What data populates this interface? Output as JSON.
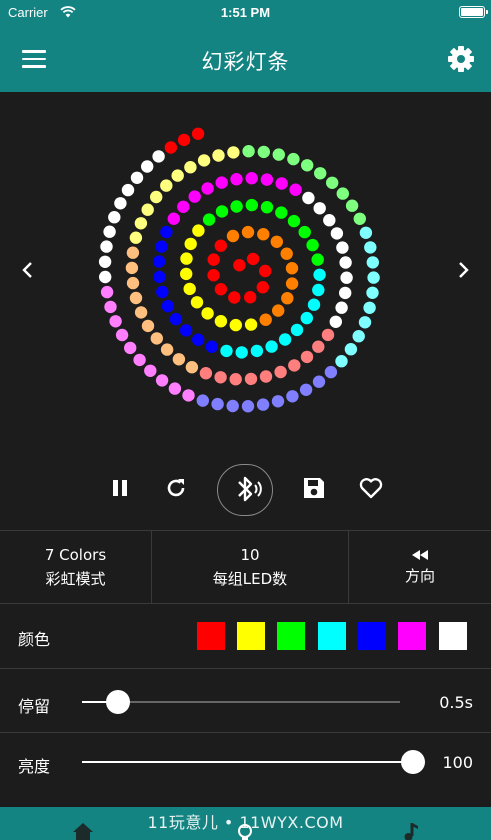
{
  "status": {
    "carrier": "Carrier",
    "time": "1:51 PM"
  },
  "header": {
    "title": "幻彩灯条",
    "menu_icon": "hamburger-menu-icon",
    "settings_icon": "gear-icon"
  },
  "display": {
    "prev_icon": "chevron-left-icon",
    "next_icon": "chevron-right-icon",
    "rainbow": [
      "#ff0000",
      "#ff8000",
      "#ffff00",
      "#00ff00",
      "#00ffff",
      "#0000ff",
      "#ff00ff",
      "#ffffff"
    ]
  },
  "controls": [
    "pause-icon",
    "refresh-icon",
    "bluetooth-icon",
    "save-icon",
    "heart-icon"
  ],
  "info": {
    "mode_top": "7 Colors",
    "mode_label": "彩虹模式",
    "count_top": "10",
    "count_label": "每组LED数",
    "direction_icon": "rewind-icon",
    "direction_label": "方向"
  },
  "colors": {
    "label": "颜色",
    "swatches": [
      "#ff0000",
      "#ffff00",
      "#00ff00",
      "#00ffff",
      "#0000ff",
      "#ff00ff",
      "#ffffff"
    ]
  },
  "pause": {
    "label": "停留",
    "value": "0.5s",
    "level_percent": 8
  },
  "brightness": {
    "label": "亮度",
    "value": "100",
    "level_percent": 100
  },
  "tabbar": {
    "watermark": "11玩意儿 • 11WYX.COM",
    "tabs": [
      "home-icon",
      "bulb-icon",
      "music-icon"
    ]
  }
}
